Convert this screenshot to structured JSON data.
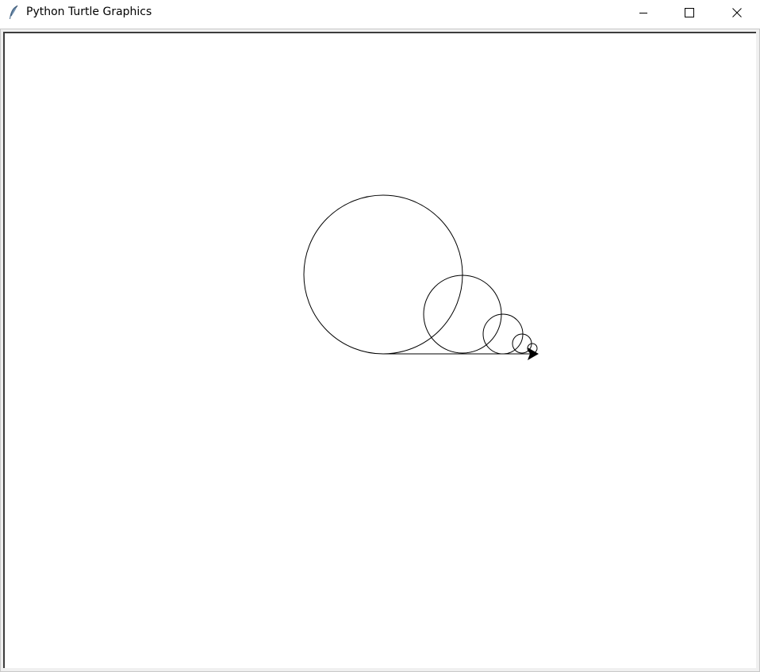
{
  "window": {
    "title": "Python Turtle Graphics",
    "app_icon": "feather-icon",
    "controls": {
      "minimize": "minimize-icon",
      "maximize": "maximize-icon",
      "close": "close-icon"
    }
  },
  "canvas": {
    "background": "#ffffff",
    "pen_color": "#000000",
    "turtle_shape": "arrow",
    "turtle_heading": "east",
    "drawing": "five circles of decreasing size resting on a common baseline, with the turtle arrow at the right end of the baseline"
  }
}
